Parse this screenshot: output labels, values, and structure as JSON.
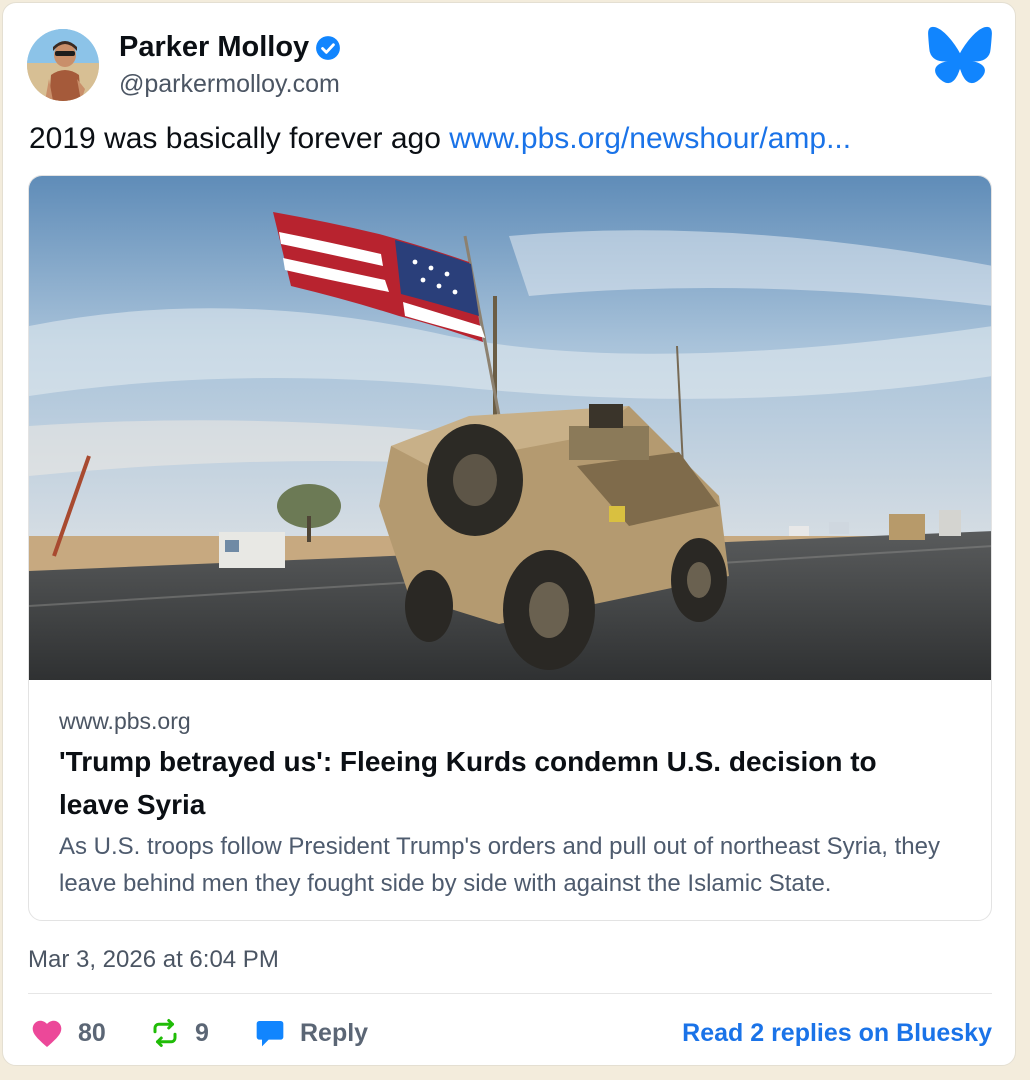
{
  "author": {
    "name": "Parker Molloy",
    "handle": "@parkermolloy.com",
    "verified": true
  },
  "post": {
    "text": "2019 was basically forever ago ",
    "link_text": "www.pbs.org/newshour/amp..."
  },
  "embed": {
    "domain": "www.pbs.org",
    "title": "'Trump betrayed us': Fleeing Kurds condemn U.S. decision to leave Syria",
    "description": "As U.S. troops follow President Trump's orders and pull out of northeast Syria, they leave behind men they fought side by side with against the Islamic State."
  },
  "timestamp": "Mar 3, 2026 at 6:04 PM",
  "actions": {
    "likes": "80",
    "reposts": "9",
    "reply_label": "Reply",
    "read_replies_label": "Read 2 replies on Bluesky"
  },
  "icons": {
    "like": "heart-icon",
    "repost": "repost-icon",
    "reply": "reply-bubble-icon",
    "brand": "bluesky-butterfly-icon",
    "verified": "verified-check-icon"
  },
  "colors": {
    "brand": "#1185fe",
    "link": "#1a73e8",
    "like": "#ec4899",
    "repost": "#20bc07",
    "verified": "#1185fe"
  }
}
